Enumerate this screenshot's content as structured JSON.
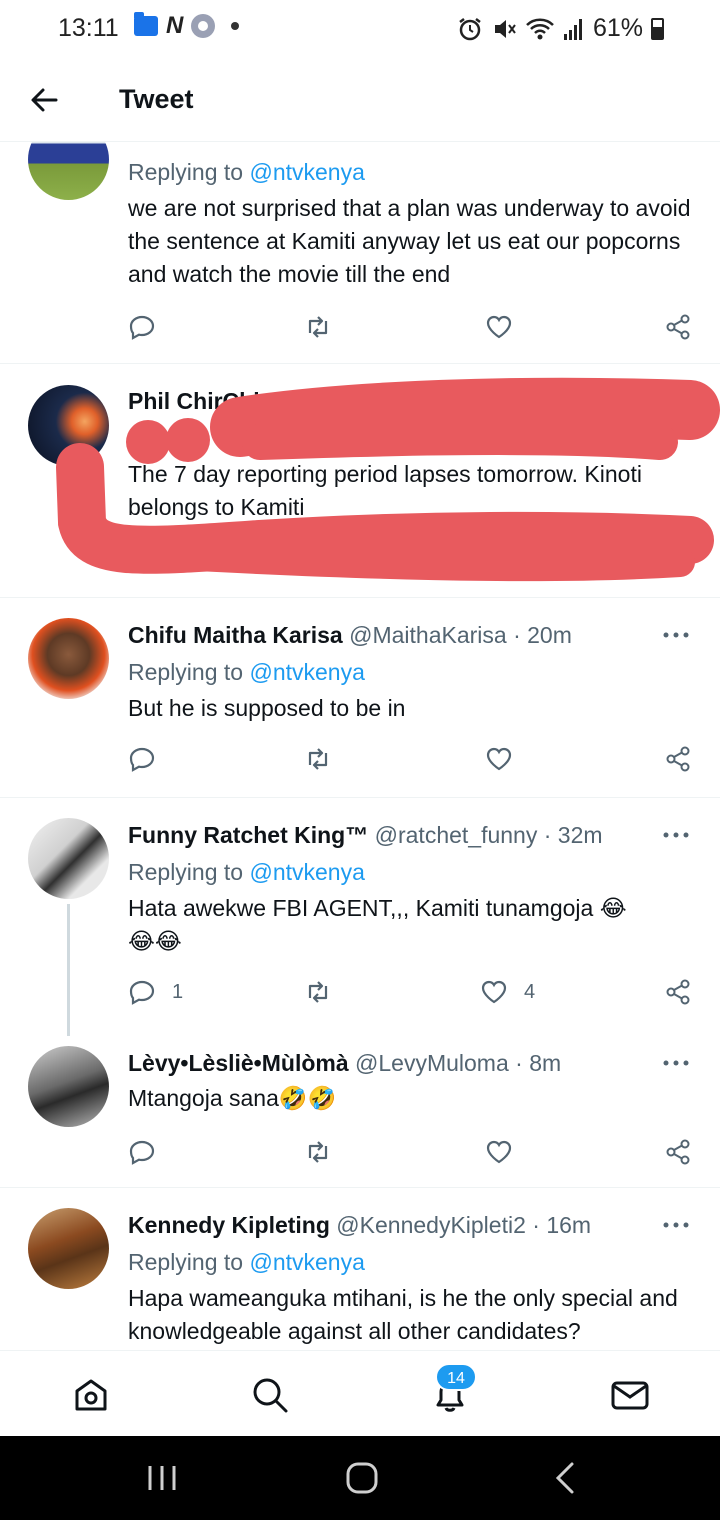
{
  "status_bar": {
    "time": "13:11",
    "battery": "61%"
  },
  "header": {
    "title": "Tweet"
  },
  "tweets": [
    {
      "name": "",
      "reply_prefix": "Replying to ",
      "reply_handle": "@ntvkenya",
      "text": "we are not surprised that a plan was underway to avoid the sentence at Kamiti anyway let us eat our popcorns and watch the movie till the end"
    },
    {
      "name": "Phil ChirChir",
      "handle_time": "@r",
      "text": "The 7 day reporting period lapses tomorrow. Kinoti belongs to Kamiti"
    },
    {
      "name": "Chifu Maitha Karisa",
      "handle_time": "@MaithaKarisa · 20m",
      "reply_prefix": "Replying to ",
      "reply_handle": "@ntvkenya",
      "text": "But he is supposed to be in"
    },
    {
      "name": "Funny Ratchet King™",
      "handle_time": "@ratchet_funny · 32m",
      "reply_prefix": "Replying to ",
      "reply_handle": "@ntvkenya",
      "text": "Hata awekwe FBI AGENT,,, Kamiti tunamgoja 😂😂😂",
      "reply_count": "1",
      "like_count": "4"
    },
    {
      "name": "Lèvy•Lèsliè•Mùlòmà",
      "handle_time": "@LevyMuloma · 8m",
      "text": "Mtangoja sana🤣🤣"
    },
    {
      "name": "Kennedy Kipleting",
      "handle_time": "@KennedyKipleti2 · 16m",
      "reply_prefix": "Replying to ",
      "reply_handle": "@ntvkenya",
      "text": "Hapa wameanguka mtihani, is he the only special and knowledgeable against all other candidates?"
    }
  ],
  "bottom_nav": {
    "notification_badge": "14"
  },
  "colors": {
    "accent": "#1d9bf0",
    "scribble": "#e85a5e",
    "muted": "#536471"
  }
}
